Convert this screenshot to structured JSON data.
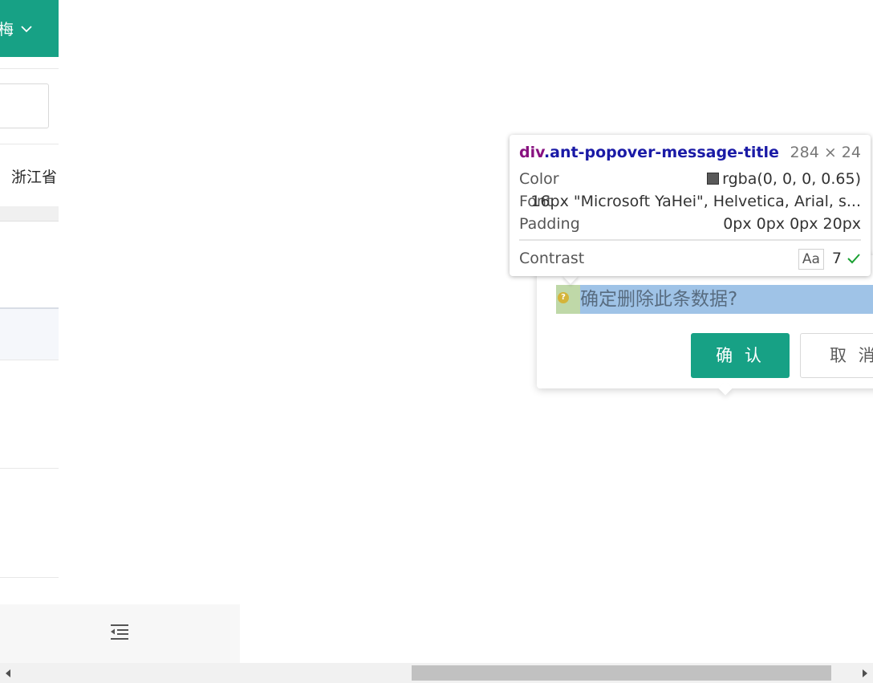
{
  "header": {
    "user_name": "梅"
  },
  "table": {
    "row_text": "浙江省"
  },
  "popconfirm": {
    "title": "确定删除此条数据?",
    "ok_label": "确 认",
    "cancel_label": "取 消",
    "icon": "question-circle-icon"
  },
  "inspect_tooltip": {
    "element_tag": "div",
    "element_class": ".ant-popover-message-title",
    "dimensions": "284 × 24",
    "color_label": "Color",
    "color_value": "rgba(0, 0, 0, 0.65)",
    "font_label": "Font",
    "font_value": "16px \"Microsoft YaHei\", Helvetica, Arial, s...",
    "padding_label": "Padding",
    "padding_value": "0px 0px 0px 20px",
    "contrast_label": "Contrast",
    "contrast_sample": "Aa",
    "contrast_value": "7"
  },
  "sider": {
    "collapse_icon": "menu-fold-icon"
  },
  "colors": {
    "primary": "#17a185",
    "selection": "#9fc3e7"
  }
}
